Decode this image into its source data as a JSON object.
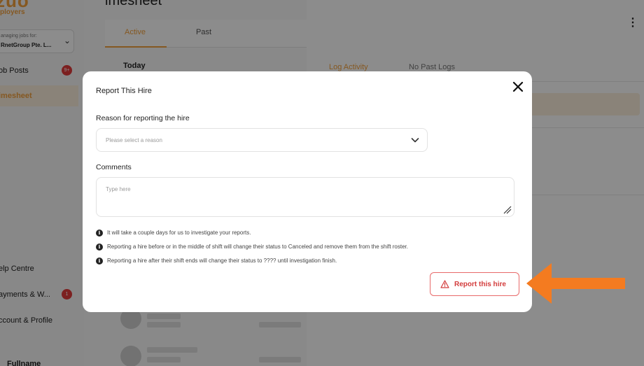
{
  "sidebar": {
    "brand": "zuo",
    "brand_sub": "ployers",
    "org_label": "anaging jobs for:",
    "org_name": "RnetGroup Pte. L...",
    "items": [
      {
        "label": "ob Posts",
        "badge": "9+"
      },
      {
        "label": "imesheet",
        "active": true
      },
      {
        "label": "elp Centre"
      },
      {
        "label": "ayments & W...",
        "badge": "1"
      },
      {
        "label": "ccount & Profile"
      }
    ],
    "user_name": "Fullname"
  },
  "timesheet": {
    "title": "imesheet",
    "tabs": [
      "Active",
      "Past"
    ],
    "section": "Today"
  },
  "detail_pane": {
    "tab_log": "Log Activity",
    "tab_past": "No Past Logs"
  },
  "modal": {
    "title": "Report This Hire",
    "reason_label": "Reason for reporting the hire",
    "reason_placeholder": "Please select a reason",
    "comments_label": "Comments",
    "comments_placeholder": "Type here",
    "notes": [
      "It will take a couple days for us to investigate your reports.",
      "Reporting a hire before or in the middle of shift will change their status to Canceled and remove them from the shift roster.",
      "Reporting a hire after their shift ends will change their status to ???? until investigation finish."
    ],
    "report_button": "Report this hire"
  },
  "colors": {
    "accent": "#f2a03d",
    "danger": "#d33c3c",
    "arrow": "#f47b20"
  },
  "icons": {
    "close": "close-icon",
    "select": "chevron-down-icon",
    "info": "info-icon",
    "report": "warning-triangle-icon",
    "annotation": "arrow-left-icon"
  }
}
